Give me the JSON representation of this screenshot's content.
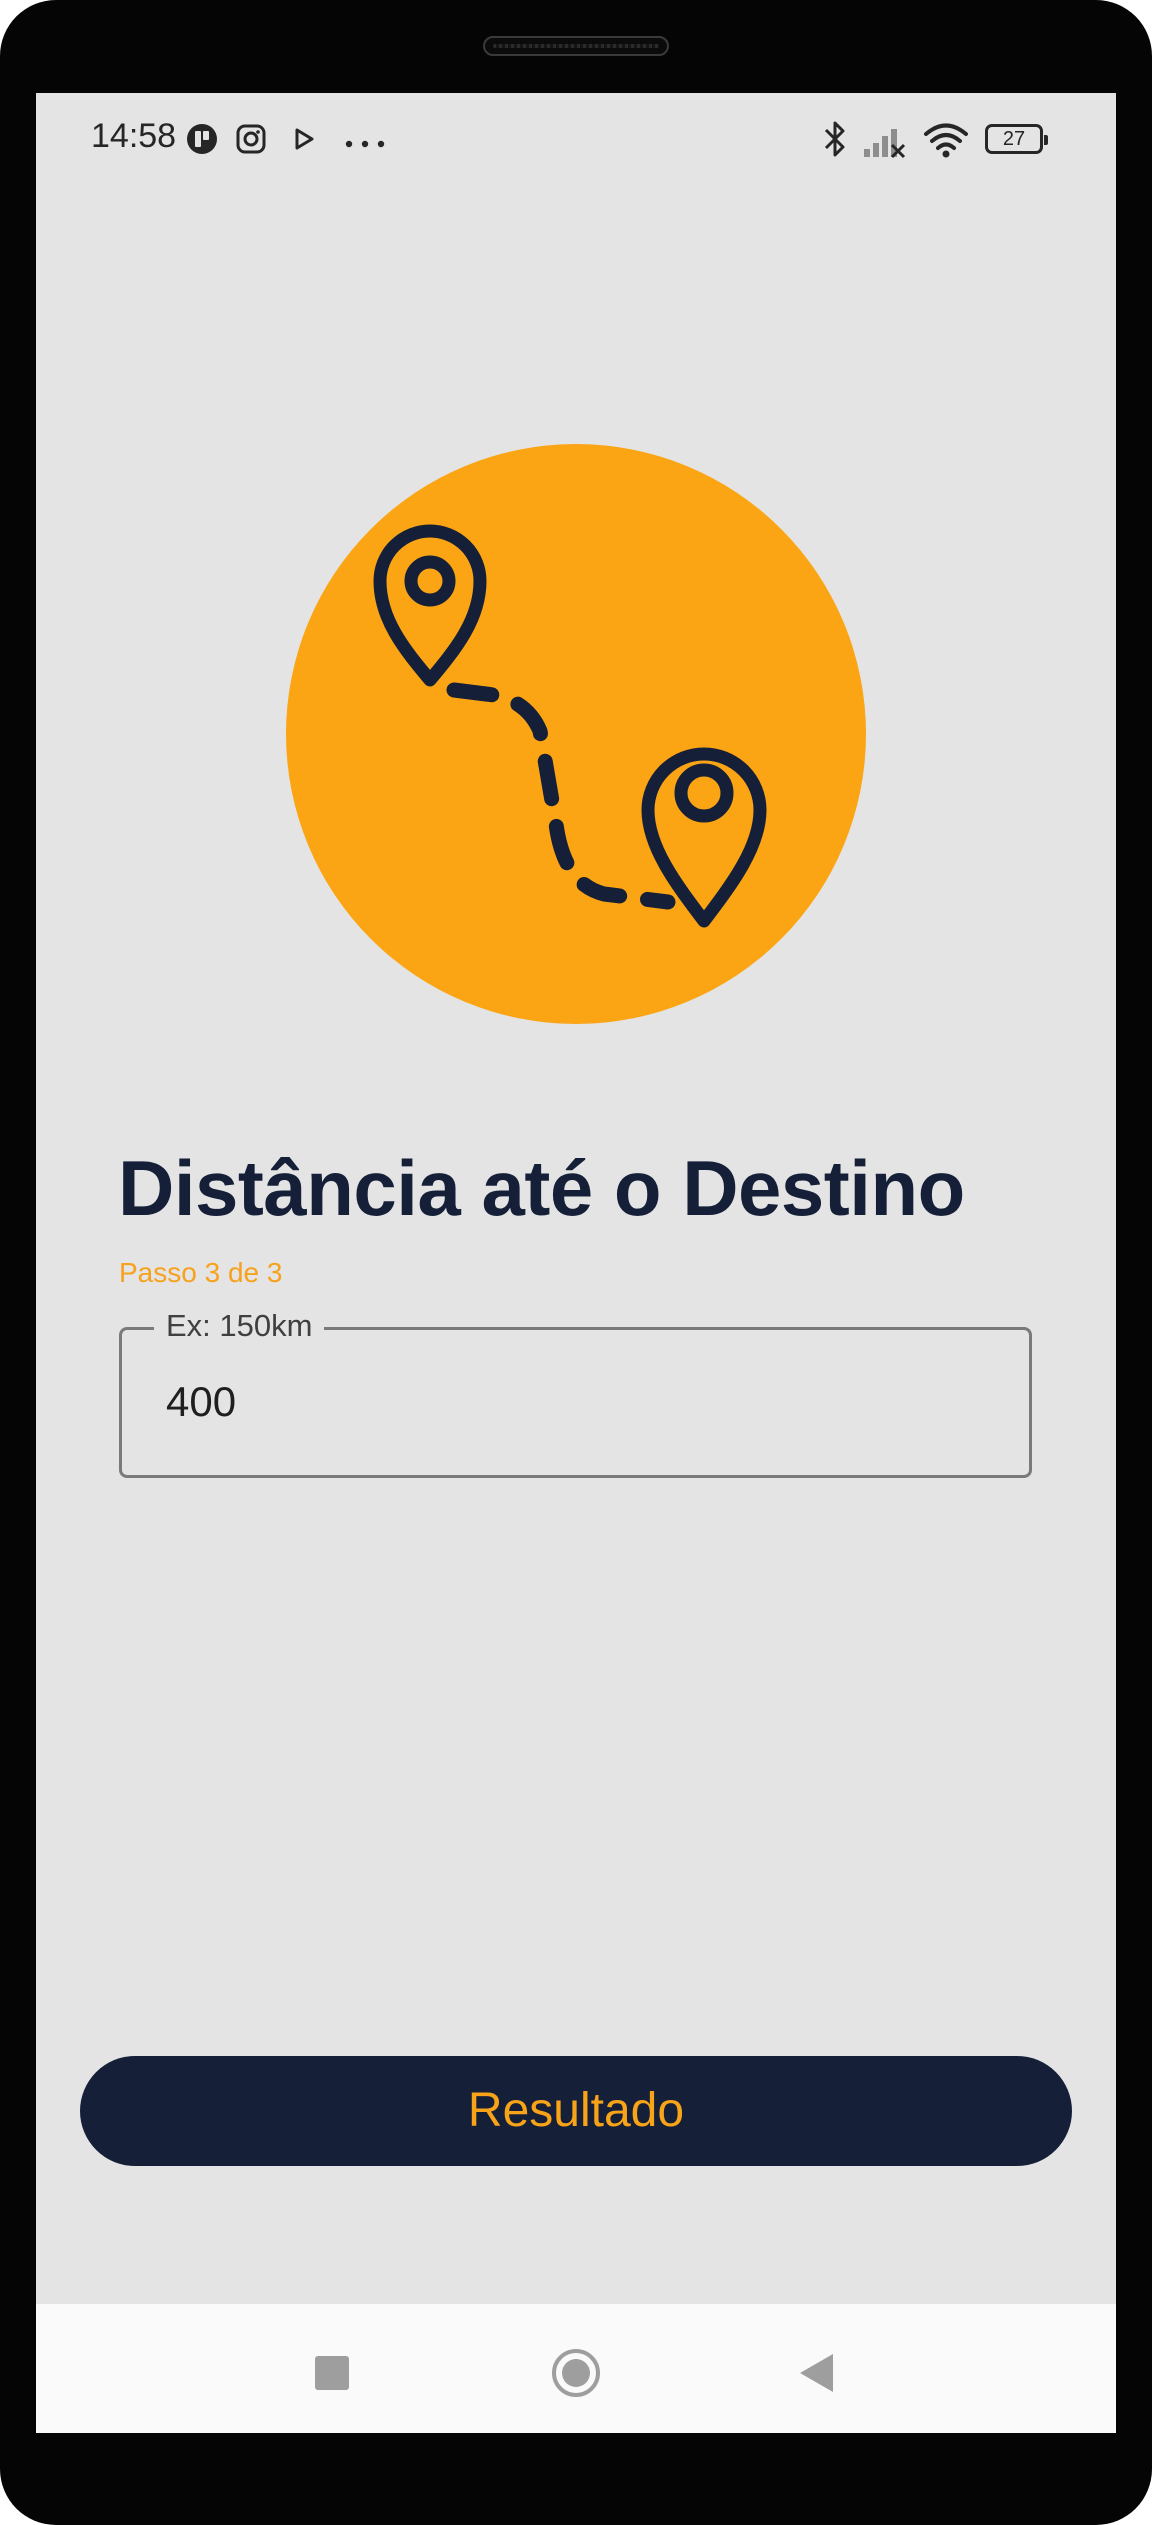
{
  "status_bar": {
    "time": "14:58",
    "left_icons": [
      "app-notification-icon",
      "instagram-icon",
      "play-store-icon",
      "more-notifications-icon"
    ],
    "right_icons": [
      "bluetooth-icon",
      "signal-icon",
      "wifi-icon"
    ],
    "battery_level": "27"
  },
  "hero": {
    "icon": "route-map-pin-icon",
    "background_color": "#fba515",
    "icon_color": "#152038"
  },
  "screen": {
    "title": "Distância até o Destino",
    "step": "Passo 3 de 3"
  },
  "distance_input": {
    "label": "Ex: 150km",
    "value": "400"
  },
  "result_button": {
    "label": "Resultado"
  },
  "nav_bar": {
    "icons": [
      "recents-icon",
      "home-icon",
      "back-icon"
    ]
  },
  "colors": {
    "accent": "#f9a418",
    "dark": "#152038",
    "background": "#e4e4e4"
  }
}
